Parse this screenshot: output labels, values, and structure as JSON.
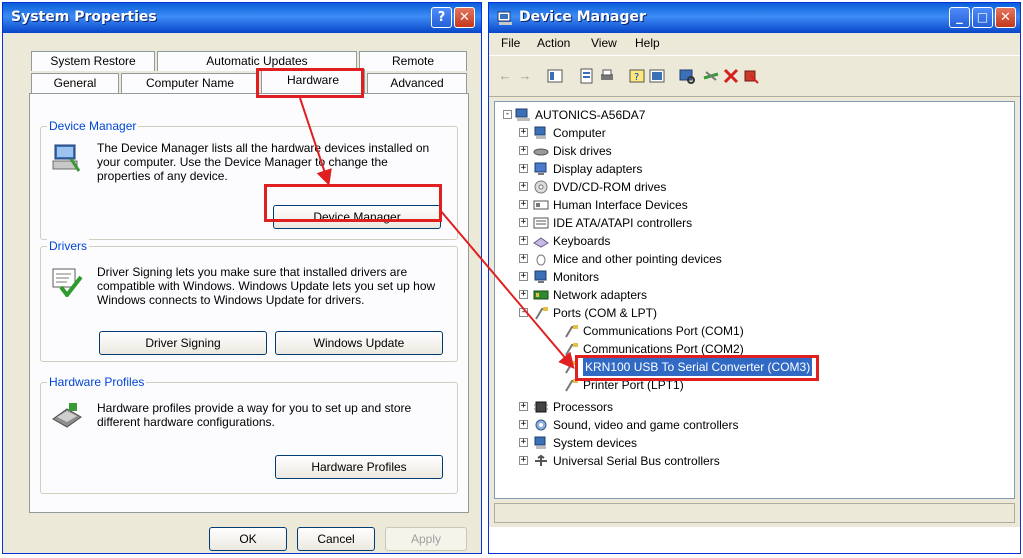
{
  "system_properties": {
    "title": "System Properties",
    "help_glyph": "?",
    "close_glyph": "✕",
    "tabs_back": [
      "System Restore",
      "Automatic Updates",
      "Remote"
    ],
    "tabs_front": [
      "General",
      "Computer Name",
      "Hardware",
      "Advanced"
    ],
    "device_manager_group": {
      "title": "Device Manager",
      "text": "The Device Manager lists all the hardware devices installed on your computer. Use the Device Manager to change the properties of any device.",
      "button": "Device Manager"
    },
    "drivers_group": {
      "title": "Drivers",
      "text": "Driver Signing lets you make sure that installed drivers are compatible with Windows. Windows Update lets you set up how Windows connects to Windows Update for drivers.",
      "button_signing": "Driver Signing",
      "button_update": "Windows Update"
    },
    "profiles_group": {
      "title": "Hardware Profiles",
      "text": "Hardware profiles provide a way for you to set up and store different hardware configurations.",
      "button": "Hardware Profiles"
    },
    "footer": {
      "ok": "OK",
      "cancel": "Cancel",
      "apply": "Apply"
    }
  },
  "device_manager": {
    "title": "Device Manager",
    "minimize_glyph": "_",
    "maximize_glyph": "□",
    "close_glyph": "✕",
    "menu": [
      "File",
      "Action",
      "View",
      "Help"
    ],
    "root": "AUTONICS-A56DA7",
    "categories_top": [
      "Computer",
      "Disk drives",
      "Display adapters",
      "DVD/CD-ROM drives",
      "Human Interface Devices",
      "IDE ATA/ATAPI controllers",
      "Keyboards",
      "Mice and other pointing devices",
      "Monitors",
      "Network adapters"
    ],
    "ports": {
      "label": "Ports (COM & LPT)",
      "children": [
        "Communications Port (COM1)",
        "Communications Port (COM2)",
        "KRN100 USB To Serial Converter (COM3)",
        "Printer Port (LPT1)"
      ],
      "selected_index": 2
    },
    "categories_bottom": [
      "Processors",
      "Sound, video and game controllers",
      "System devices",
      "Universal Serial Bus controllers"
    ]
  },
  "colors": {
    "titlebar": "#0a5fd8",
    "annotation_red": "#e02020",
    "selection": "#316ac5"
  }
}
